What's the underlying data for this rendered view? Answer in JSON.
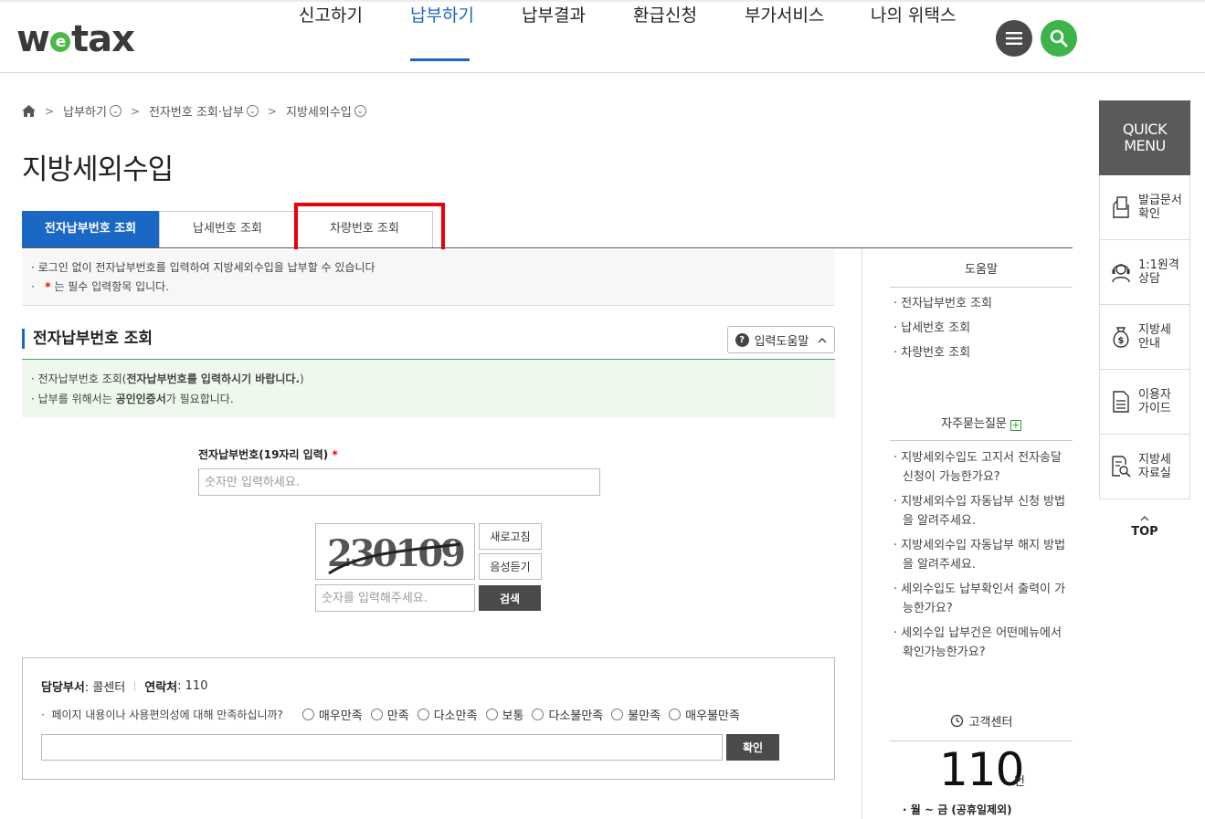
{
  "header": {
    "logo_pre": "w",
    "logo_e": "e",
    "logo_post": "tax",
    "nav": [
      "신고하기",
      "납부하기",
      "납부결과",
      "환급신청",
      "부가서비스",
      "나의 위택스"
    ],
    "active_nav": "납부하기"
  },
  "breadcrumb": [
    "납부하기",
    "전자번호 조회·납부",
    "지방세외수입"
  ],
  "page_title": "지방세외수입",
  "tabs": [
    "전자납부번호 조회",
    "납세번호 조회",
    "차량번호 조회"
  ],
  "notice": {
    "line1": "로그인 없이 전자납부번호를 입력하여 지방세외수입을 납부할 수 있습니다",
    "line2_mark": "*",
    "line2": "는 필수 입력항목 입니다."
  },
  "section": {
    "title": "전자납부번호 조회",
    "help_button": "입력도움말",
    "info1_pre": "전자납부번호 조회(",
    "info1_bold": "전자납부번호를 입력하시기 바랍니다.",
    "info1_post": ")",
    "info2_pre": "납부를 위해서는 ",
    "info2_bold": "공인인증서",
    "info2_post": "가 필요합니다."
  },
  "form": {
    "label": "전자납부번호(19자리 입력)",
    "required_mark": "*",
    "number_placeholder": "숫자만 입력하세요.",
    "captcha_text": "230109",
    "refresh_button": "새로고침",
    "audio_button": "음성듣기",
    "captcha_placeholder": "숫자를 입력해주세요.",
    "search_button": "검색"
  },
  "survey": {
    "dept_label": "담당부서",
    "dept_value": ": 콜센터",
    "contact_label": "연락처",
    "contact_value": ": 110",
    "question": "페이지 내용이나 사용편의성에 대해 만족하십니까?",
    "options": [
      "매우만족",
      "만족",
      "다소만족",
      "보통",
      "다소불만족",
      "불만족",
      "매우불만족"
    ],
    "confirm_button": "확인"
  },
  "help_panel": {
    "title": "도움말",
    "links": [
      "전자납부번호 조회",
      "납세번호 조회",
      "차량번호 조회"
    ],
    "faq_title": "자주묻는질문",
    "faq_plus": "+",
    "faqs": [
      "지방세외수입도 고지서 전자송달 신청이 가능한가요?",
      "지방세외수입 자동납부 신청 방법을 알려주세요.",
      "지방세외수입 자동납부 해지 방법을 알려주세요.",
      "세외수입도 납부확인서 출력이 가능한가요?",
      "세외수입 납부건은 어떤메뉴에서 확인가능한가요?"
    ],
    "cs_title": "고객센터",
    "cs_number": "110",
    "cs_unit": "번",
    "cs_hours": "월 ~ 금 (공휴일제외)"
  },
  "quick_menu": {
    "head1": "QUICK",
    "head2": "MENU",
    "items": [
      {
        "l1": "발급문서",
        "l2": "확인"
      },
      {
        "l1": "1:1원격",
        "l2": "상담"
      },
      {
        "l1": "지방세",
        "l2": "안내"
      },
      {
        "l1": "이용자",
        "l2": "가이드"
      },
      {
        "l1": "지방세",
        "l2": "자료실"
      }
    ],
    "top_label": "TOP"
  }
}
